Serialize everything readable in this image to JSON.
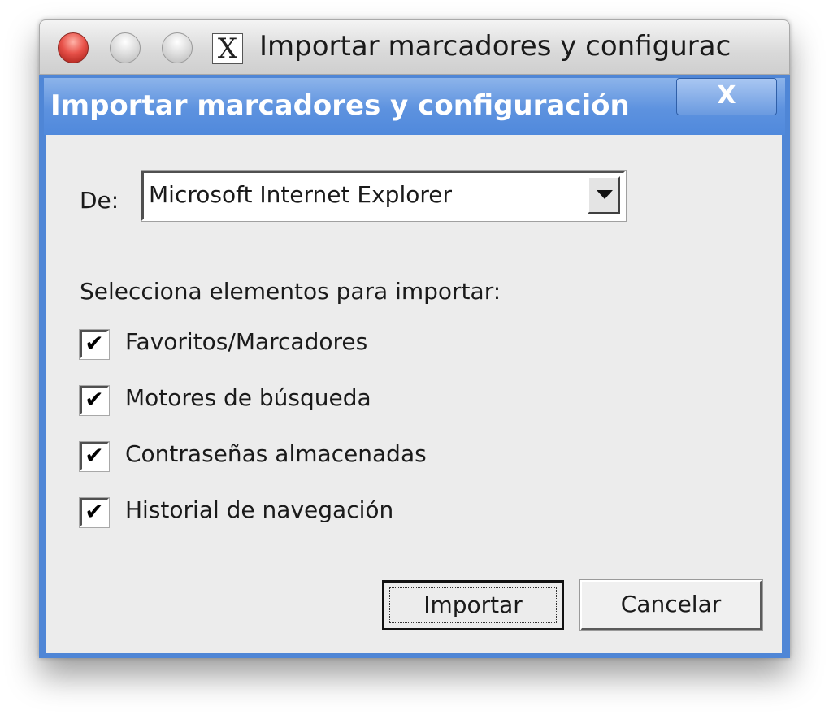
{
  "mac_window": {
    "title": "Importar marcadores y configurac",
    "x11_icon_label": "X",
    "buttons": [
      "close",
      "minimize",
      "zoom"
    ]
  },
  "dialog": {
    "title": "Importar marcadores y configuración",
    "close_label": "X",
    "from_label": "De:",
    "source_select": {
      "selected": "Microsoft Internet Explorer"
    },
    "section_label": "Selecciona elementos para importar:",
    "items": [
      {
        "label": "Favoritos/Marcadores",
        "checked": true,
        "check_glyph": "✔"
      },
      {
        "label": "Motores de búsqueda",
        "checked": true,
        "check_glyph": "✔"
      },
      {
        "label": "Contraseñas almacenadas",
        "checked": true,
        "check_glyph": "✔"
      },
      {
        "label": "Historial de navegación",
        "checked": true,
        "check_glyph": "✔"
      }
    ],
    "import_label": "Importar",
    "cancel_label": "Cancelar"
  },
  "colors": {
    "title_blue": "#5089dc",
    "dialog_background": "#ececec",
    "close_red": "#e8524a"
  }
}
